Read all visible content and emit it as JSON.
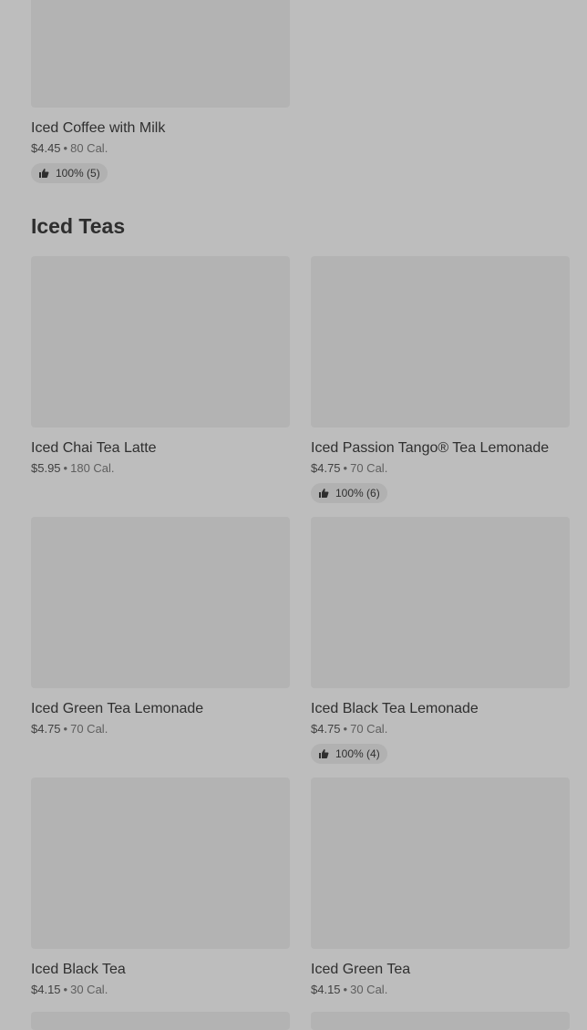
{
  "top_item": {
    "name": "Iced Coffee with Milk",
    "price": "$4.45",
    "calories": "80 Cal.",
    "rating": "100% (5)"
  },
  "section": {
    "title": "Iced Teas",
    "items": [
      {
        "name": "Iced Chai Tea Latte",
        "price": "$5.95",
        "calories": "180 Cal."
      },
      {
        "name": "Iced Passion Tango® Tea Lemonade",
        "price": "$4.75",
        "calories": "70 Cal.",
        "rating": "100% (6)"
      },
      {
        "name": "Iced Green Tea Lemonade",
        "price": "$4.75",
        "calories": "70 Cal."
      },
      {
        "name": "Iced Black Tea Lemonade",
        "price": "$4.75",
        "calories": "70 Cal.",
        "rating": "100% (4)"
      },
      {
        "name": "Iced Black Tea",
        "price": "$4.15",
        "calories": "30 Cal."
      },
      {
        "name": "Iced Green Tea",
        "price": "$4.15",
        "calories": "30 Cal."
      }
    ]
  },
  "separator": "•",
  "icons": {
    "rating": "thumbs-up-icon"
  }
}
